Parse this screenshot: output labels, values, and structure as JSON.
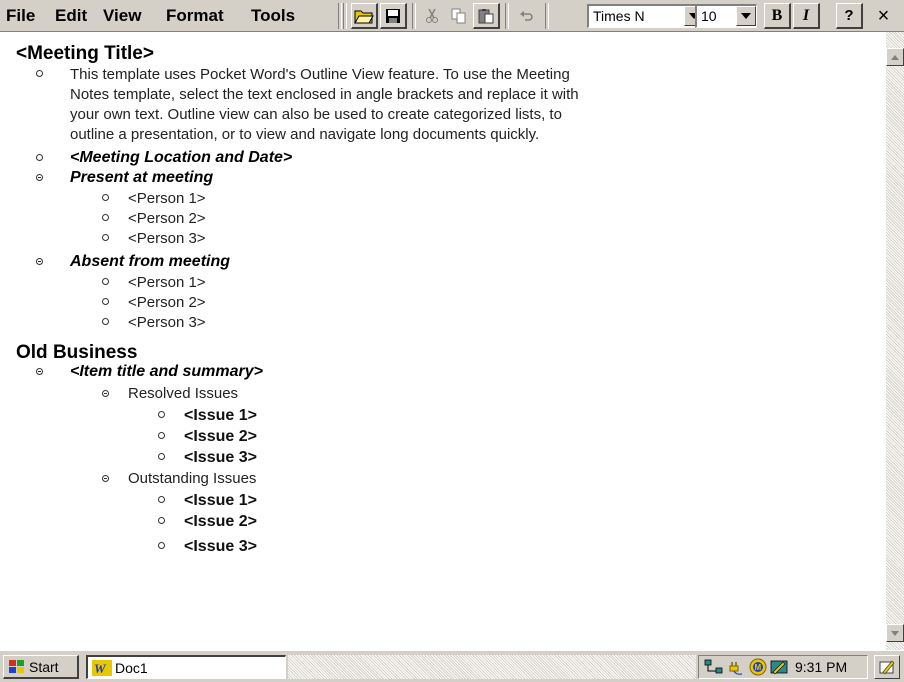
{
  "menu": {
    "file": "File",
    "edit": "Edit",
    "view": "View",
    "format": "Format",
    "tools": "Tools"
  },
  "toolbar": {
    "font_name": "Times N",
    "font_size": "10",
    "bold_label": "B",
    "italic_label": "I",
    "help_label": "?",
    "close_label": "×"
  },
  "document": {
    "meeting_title": "<Meeting Title>",
    "intro_lines": [
      "This template uses Pocket Word's Outline View feature. To use the Meeting",
      "Notes template, select the text enclosed in angle brackets and replace it with",
      "your own text. Outline view can also be used to create categorized lists, to",
      "outline a presentation, or to view and navigate long documents quickly."
    ],
    "location_date": "<Meeting Location and Date>",
    "present_heading": "Present at meeting",
    "present_people": [
      "<Person 1>",
      "<Person 2>",
      "<Person 3>"
    ],
    "absent_heading": "Absent from meeting",
    "absent_people": [
      "<Person 1>",
      "<Person 2>",
      "<Person 3>"
    ],
    "old_business": "Old Business",
    "item_title": "<Item title and summary>",
    "resolved_heading": "Resolved Issues",
    "resolved_issues": [
      "<Issue 1>",
      "<Issue 2>",
      "<Issue 3>"
    ],
    "outstanding_heading": "Outstanding Issues",
    "outstanding_issues": [
      "<Issue 1>",
      "<Issue 2>",
      "<Issue 3>"
    ]
  },
  "taskbar": {
    "start_label": "Start",
    "task_doc_label": "Doc1",
    "clock": "9:31 PM"
  },
  "colors": {
    "chrome": "#d4d0c8",
    "window_bg": "#ffffff",
    "icon_blue": "#1f3fbf",
    "icon_yellow": "#e8c800"
  }
}
